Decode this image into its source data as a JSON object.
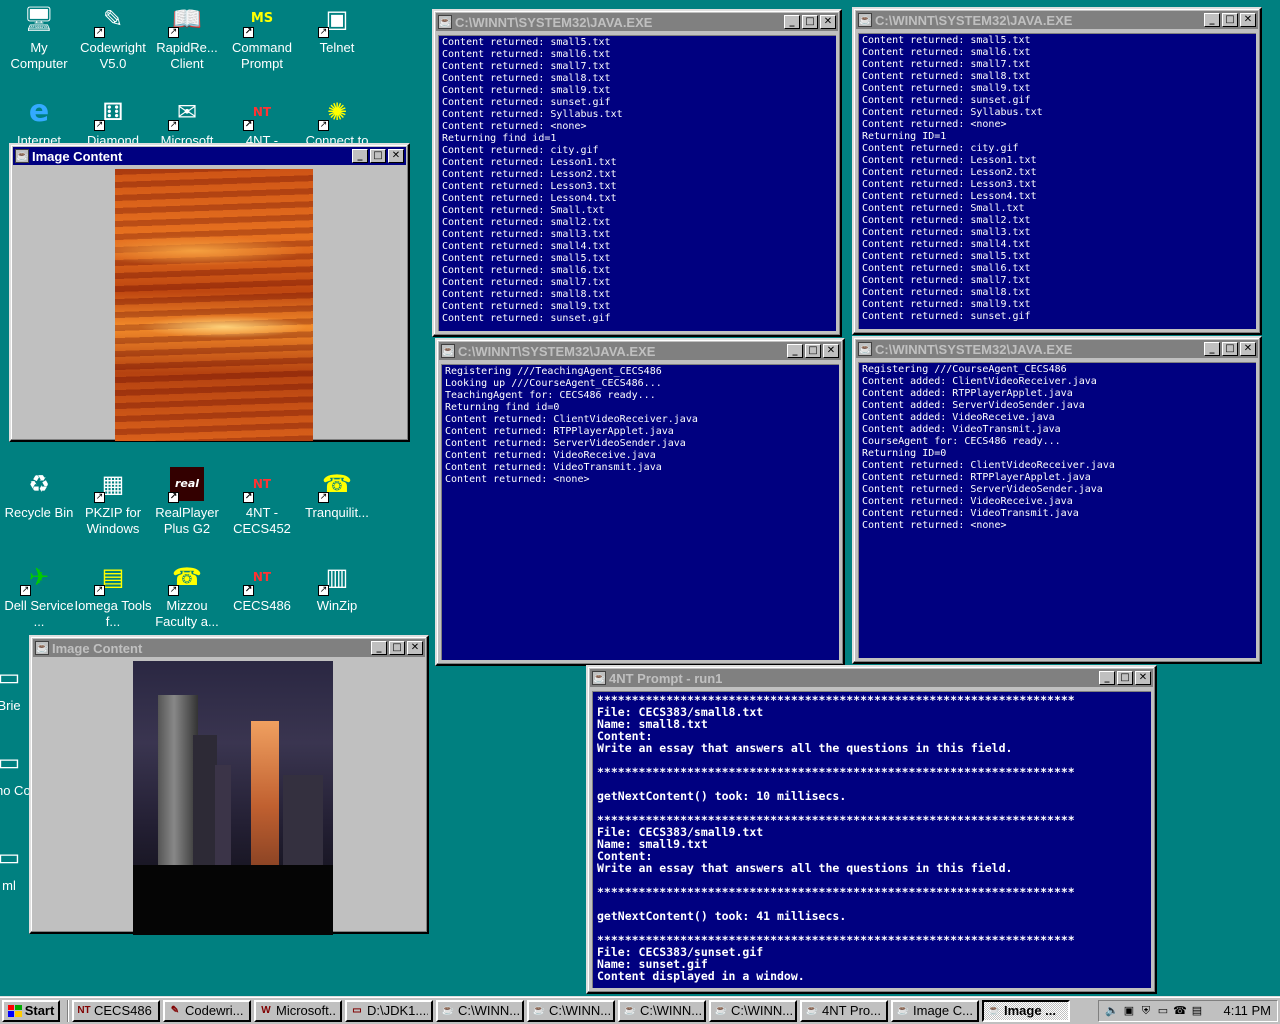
{
  "desktop_icons": [
    {
      "name": "my-computer",
      "label": "My Computer",
      "glyph": "🖥"
    },
    {
      "name": "codewright",
      "label": "Codewright V5.0",
      "glyph": "✎"
    },
    {
      "name": "rapidre-client",
      "label": "RapidRe... Client",
      "glyph": "📖"
    },
    {
      "name": "command-prompt",
      "label": "Command Prompt",
      "glyph": "MS"
    },
    {
      "name": "telnet",
      "label": "Telnet",
      "glyph": "▣"
    },
    {
      "name": "internet",
      "label": "Internet",
      "glyph": "e"
    },
    {
      "name": "diamond",
      "label": "Diamond",
      "glyph": "⚅"
    },
    {
      "name": "microsoft",
      "label": "Microsoft",
      "glyph": "✉"
    },
    {
      "name": "4nt",
      "label": "4NT -",
      "glyph": "NT"
    },
    {
      "name": "connect-to",
      "label": "Connect to",
      "glyph": "✺"
    },
    {
      "name": "recycle-bin",
      "label": "Recycle Bin",
      "glyph": "♻"
    },
    {
      "name": "pkzip",
      "label": "PKZIP for Windows",
      "glyph": "▦"
    },
    {
      "name": "realplayer",
      "label": "RealPlayer Plus G2",
      "glyph": "real"
    },
    {
      "name": "4nt-cecs452",
      "label": "4NT - CECS452",
      "glyph": "NT"
    },
    {
      "name": "tranquilit",
      "label": "Tranquilit...",
      "glyph": "☎"
    },
    {
      "name": "dell-service",
      "label": "Dell Service ...",
      "glyph": "✈"
    },
    {
      "name": "iomega-tools",
      "label": "Iomega Tools f...",
      "glyph": "▤"
    },
    {
      "name": "mizzou-faculty",
      "label": "Mizzou Faculty a...",
      "glyph": "☎"
    },
    {
      "name": "cecs486",
      "label": "CECS486",
      "glyph": "NT"
    },
    {
      "name": "winzip",
      "label": "WinZip",
      "glyph": "▥"
    },
    {
      "name": "brie",
      "label": "Brie",
      "glyph": "▭"
    },
    {
      "name": "sho-co",
      "label": "Sho Co",
      "glyph": "▭"
    },
    {
      "name": "ml",
      "label": "ml",
      "glyph": "▭"
    }
  ],
  "windows": {
    "img1": {
      "title": "Image Content"
    },
    "img2": {
      "title": "Image Content"
    },
    "java1": {
      "title": "C:\\WINNT\\SYSTEM32\\JAVA.EXE",
      "lines": [
        "Content returned: small5.txt",
        "Content returned: small6.txt",
        "Content returned: small7.txt",
        "Content returned: small8.txt",
        "Content returned: small9.txt",
        "Content returned: sunset.gif",
        "Content returned: Syllabus.txt",
        "Content returned: <none>",
        "Returning find id=1",
        "Content returned: city.gif",
        "Content returned: Lesson1.txt",
        "Content returned: Lesson2.txt",
        "Content returned: Lesson3.txt",
        "Content returned: Lesson4.txt",
        "Content returned: Small.txt",
        "Content returned: small2.txt",
        "Content returned: small3.txt",
        "Content returned: small4.txt",
        "Content returned: small5.txt",
        "Content returned: small6.txt",
        "Content returned: small7.txt",
        "Content returned: small8.txt",
        "Content returned: small9.txt",
        "Content returned: sunset.gif"
      ]
    },
    "java2": {
      "title": "C:\\WINNT\\SYSTEM32\\JAVA.EXE",
      "lines": [
        "Content returned: small5.txt",
        "Content returned: small6.txt",
        "Content returned: small7.txt",
        "Content returned: small8.txt",
        "Content returned: small9.txt",
        "Content returned: sunset.gif",
        "Content returned: Syllabus.txt",
        "Content returned: <none>",
        "Returning ID=1",
        "Content returned: city.gif",
        "Content returned: Lesson1.txt",
        "Content returned: Lesson2.txt",
        "Content returned: Lesson3.txt",
        "Content returned: Lesson4.txt",
        "Content returned: Small.txt",
        "Content returned: small2.txt",
        "Content returned: small3.txt",
        "Content returned: small4.txt",
        "Content returned: small5.txt",
        "Content returned: small6.txt",
        "Content returned: small7.txt",
        "Content returned: small8.txt",
        "Content returned: small9.txt",
        "Content returned: sunset.gif"
      ]
    },
    "java3": {
      "title": "C:\\WINNT\\SYSTEM32\\JAVA.EXE",
      "lines": [
        "Registering ///TeachingAgent_CECS486",
        "Looking up ///CourseAgent_CECS486...",
        "TeachingAgent for: CECS486 ready...",
        "Returning find id=0",
        "Content returned: ClientVideoReceiver.java",
        "Content returned: RTPPlayerApplet.java",
        "Content returned: ServerVideoSender.java",
        "Content returned: VideoReceive.java",
        "Content returned: VideoTransmit.java",
        "Content returned: <none>"
      ]
    },
    "java4": {
      "title": "C:\\WINNT\\SYSTEM32\\JAVA.EXE",
      "lines": [
        "Registering ///CourseAgent_CECS486",
        "Content added: ClientVideoReceiver.java",
        "Content added: RTPPlayerApplet.java",
        "Content added: ServerVideoSender.java",
        "Content added: VideoReceive.java",
        "Content added: VideoTransmit.java",
        "CourseAgent for: CECS486 ready...",
        "Returning ID=0",
        "Content returned: ClientVideoReceiver.java",
        "Content returned: RTPPlayerApplet.java",
        "Content returned: ServerVideoSender.java",
        "Content returned: VideoReceive.java",
        "Content returned: VideoTransmit.java",
        "Content returned: <none>"
      ]
    },
    "prompt": {
      "title": "4NT Prompt - run1",
      "lines": [
        "*********************************************************************",
        "File: CECS383/small8.txt",
        "Name: small8.txt",
        "Content:",
        "Write an essay that answers all the questions in this field.",
        "",
        "*********************************************************************",
        "",
        "getNextContent() took: 10 millisecs.",
        "",
        "*********************************************************************",
        "File: CECS383/small9.txt",
        "Name: small9.txt",
        "Content:",
        "Write an essay that answers all the questions in this field.",
        "",
        "*********************************************************************",
        "",
        "getNextContent() took: 41 millisecs.",
        "",
        "*********************************************************************",
        "File: CECS383/sunset.gif",
        "Name: sunset.gif",
        "Content displayed in a window."
      ]
    }
  },
  "taskbar": {
    "start_label": "Start",
    "tasks": [
      {
        "label": "CECS486",
        "icon": "NT"
      },
      {
        "label": "Codewri...",
        "icon": "✎"
      },
      {
        "label": "Microsoft...",
        "icon": "W"
      },
      {
        "label": "D:\\JDK1....",
        "icon": "▭"
      },
      {
        "label": "C:\\WINN...",
        "icon": "☕"
      },
      {
        "label": "C:\\WINN...",
        "icon": "☕"
      },
      {
        "label": "C:\\WINN...",
        "icon": "☕"
      },
      {
        "label": "C:\\WINN...",
        "icon": "☕"
      },
      {
        "label": "4NT Pro...",
        "icon": "☕"
      },
      {
        "label": "Image C...",
        "icon": "☕"
      },
      {
        "label": "Image ...",
        "icon": "☕"
      }
    ],
    "clock": "4:11 PM"
  },
  "colors": {
    "desktop": "#008080",
    "console_bg": "#000080",
    "title_active": "#000080",
    "title_inactive": "#808080"
  }
}
